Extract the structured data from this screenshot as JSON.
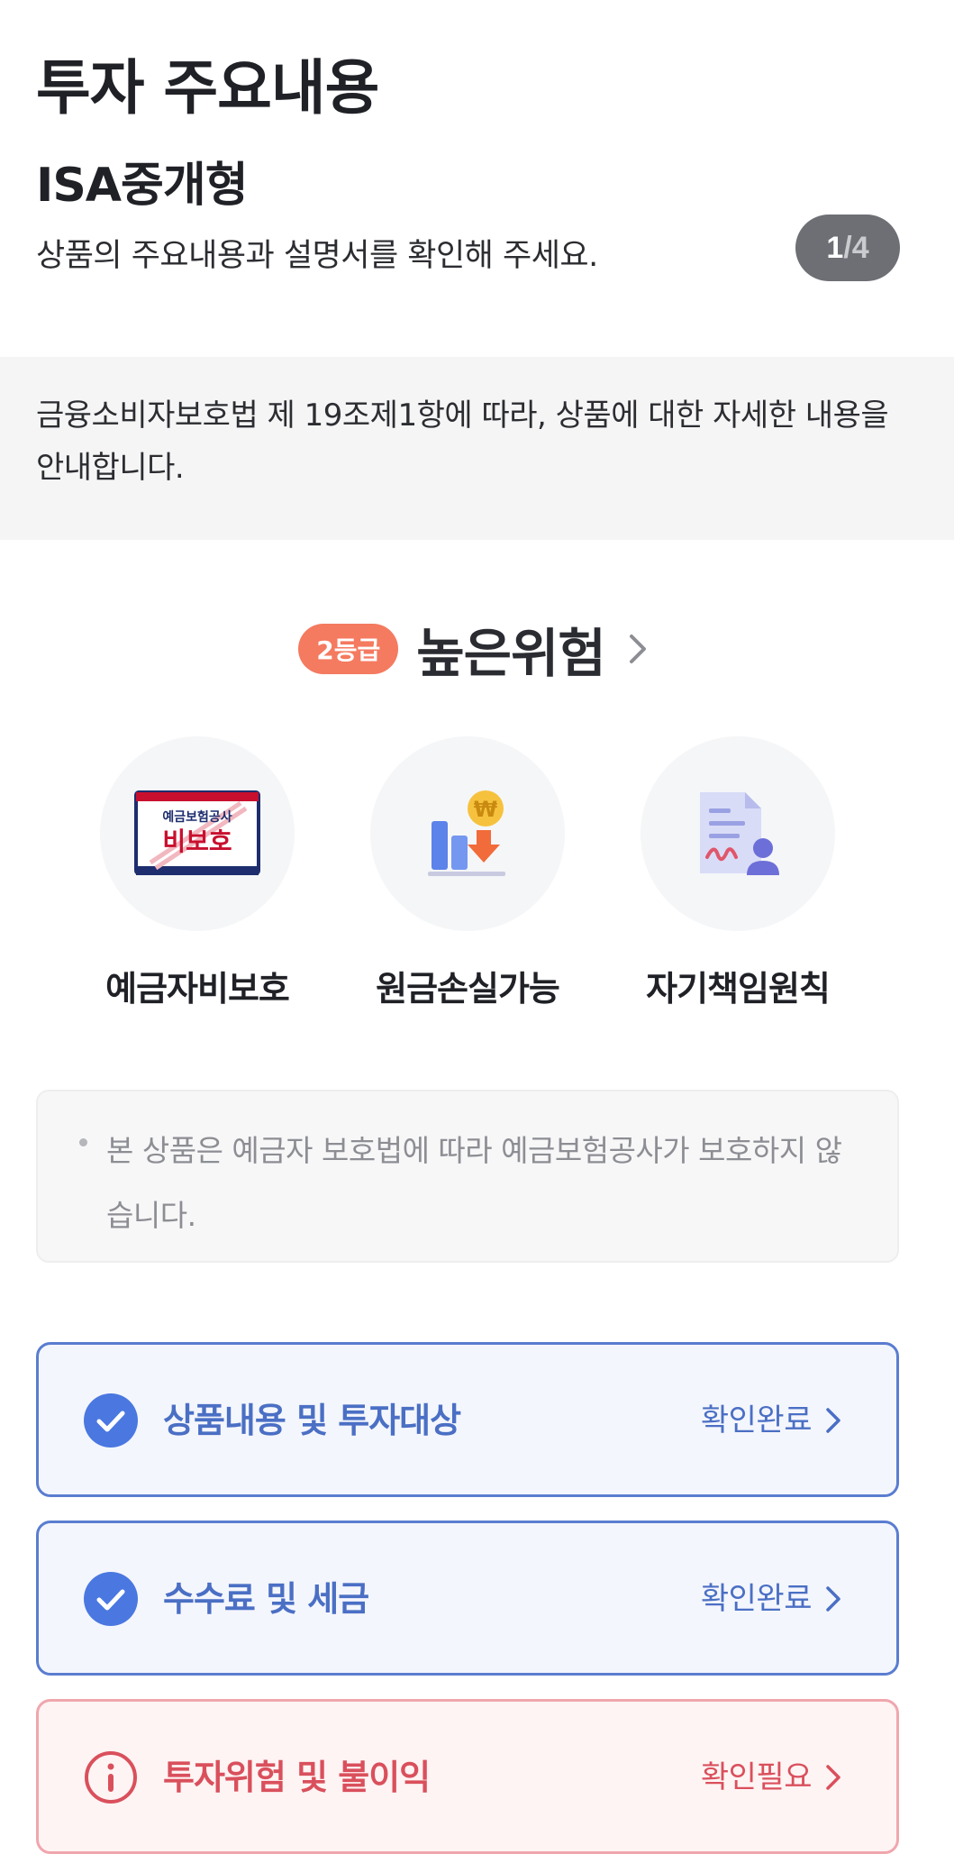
{
  "header": {
    "title": "투자 주요내용",
    "product_name": "ISA중개형",
    "subtitle": "상품의 주요내용과 설명서를 확인해 주세요.",
    "page_current": "1",
    "page_separator": "/",
    "page_total": "4"
  },
  "notice": {
    "text": "금융소비자보호법 제 19조제1항에 따라, 상품에 대한 자세한 내용을 안내합니다."
  },
  "risk": {
    "grade": "2등급",
    "level": "높은위험",
    "grade_color": "#f47a60"
  },
  "features": [
    {
      "label": "예금자비보호",
      "icon": "deposit-unprotected-icon",
      "icon_top_text": "예금보험공사",
      "icon_main_text": "비보호"
    },
    {
      "label": "원금손실가능",
      "icon": "principal-loss-icon",
      "coin_text": "₩"
    },
    {
      "label": "자기책임원칙",
      "icon": "self-responsibility-icon"
    }
  ],
  "info": {
    "text": "본 상품은 예금자 보호법에 따라 예금보험공사가 보호하지 않습니다."
  },
  "checklist": [
    {
      "title": "상품내용 및 투자대상",
      "status": "확인완료",
      "state": "done"
    },
    {
      "title": "수수료 및 세금",
      "status": "확인완료",
      "state": "done"
    },
    {
      "title": "투자위험 및 불이익",
      "status": "확인필요",
      "state": "need"
    }
  ],
  "colors": {
    "done": "#4a6fc4",
    "need": "#d9505c"
  }
}
